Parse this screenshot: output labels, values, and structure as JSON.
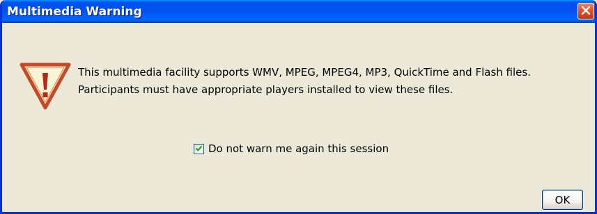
{
  "window": {
    "title": "Multimedia Warning"
  },
  "icons": {
    "warning": "warning-icon",
    "close": "close-icon",
    "check": "check-icon"
  },
  "message": {
    "line1": "This multimedia facility supports WMV, MPEG, MPEG4, MP3, QuickTime and Flash files.",
    "line2": "Participants must have appropriate players installed to view these files."
  },
  "checkbox": {
    "label": "Do not warn me again this session",
    "checked": true
  },
  "buttons": {
    "ok_label": "OK"
  },
  "colors": {
    "titlebar": "#0054e3",
    "close_button": "#e0522d",
    "warning_icon": "#c0392b",
    "dialog_bg": "#ece9d8"
  }
}
